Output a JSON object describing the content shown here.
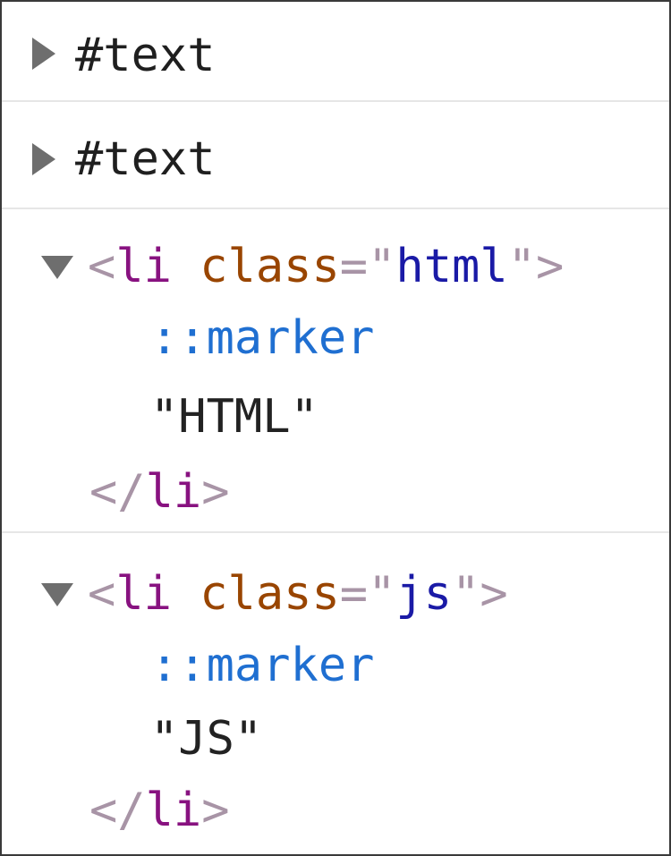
{
  "nodes": [
    {
      "type": "text-node",
      "label": "#text",
      "expanded": false
    },
    {
      "type": "text-node",
      "label": "#text",
      "expanded": false
    },
    {
      "type": "element",
      "expanded": true,
      "open_lt": "<",
      "tag": "li",
      "attr_name": "class",
      "attr_eq": "=",
      "quote_open": "\"",
      "attr_value": "html",
      "quote_close": "\"",
      "open_gt": ">",
      "pseudo": "::marker",
      "text_content": "\"HTML\"",
      "close_lt": "</",
      "close_tag": "li",
      "close_gt": ">"
    },
    {
      "type": "element",
      "expanded": true,
      "open_lt": "<",
      "tag": "li",
      "attr_name": "class",
      "attr_eq": "=",
      "quote_open": "\"",
      "attr_value": "js",
      "quote_close": "\"",
      "open_gt": ">",
      "pseudo": "::marker",
      "text_content": "\"JS\"",
      "close_lt": "</",
      "close_tag": "li",
      "close_gt": ">"
    }
  ],
  "colors": {
    "triangle": "#6e6e6e",
    "tag": "#881280",
    "attribute": "#994500",
    "attribute_value": "#1a1aa6",
    "punctuation": "#a894a6",
    "pseudo_element": "#1f6fd1",
    "text": "#1f1f1f"
  }
}
